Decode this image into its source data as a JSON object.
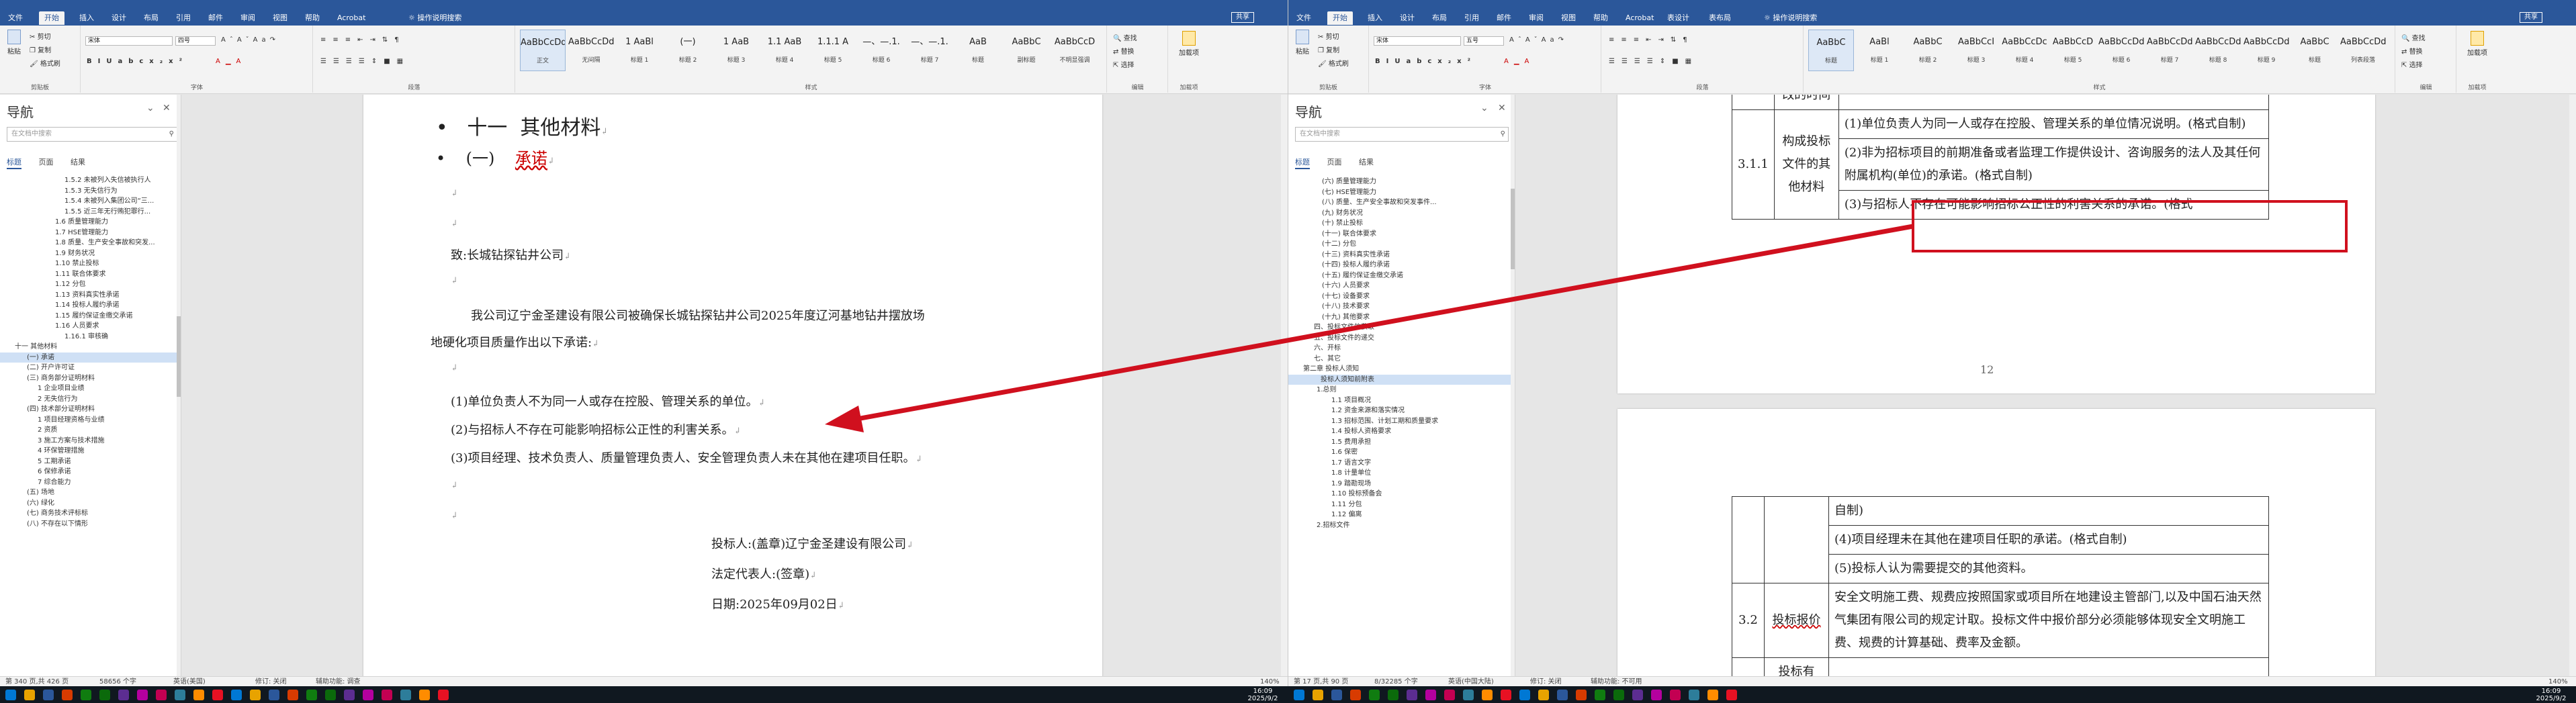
{
  "app": {
    "ribbon_tabs": [
      "文件",
      "开始",
      "插入",
      "设计",
      "布局",
      "引用",
      "邮件",
      "审阅",
      "视图",
      "帮助",
      "Acrobat"
    ],
    "ribbon_tabs_right": [
      "文件",
      "开始",
      "插入",
      "设计",
      "布局",
      "引用",
      "邮件",
      "审阅",
      "视图",
      "帮助",
      "Acrobat",
      "表设计",
      "表布局"
    ],
    "search": "操作说明搜索",
    "share": "共享",
    "clipboard": {
      "paste": "粘贴",
      "cut": "剪切",
      "copy": "复制",
      "format_painter": "格式刷",
      "label": "剪贴板"
    },
    "font": {
      "name_left": "宋体",
      "name_right": "宋体",
      "size_left": "四号",
      "size_right": "五号",
      "label": "字体"
    },
    "paragraph_label": "段落",
    "styles_label": "样式",
    "editing": {
      "find": "查找",
      "replace": "替换",
      "select": "选择",
      "label": "编辑"
    },
    "addin": {
      "name": "加载项",
      "label": "加载项"
    },
    "styles_left": [
      {
        "sample": "AaBbCcDd",
        "name": "正文"
      },
      {
        "sample": "AaBbCcDd",
        "name": "无间隔"
      },
      {
        "sample": "1 AaBl",
        "name": "标题 1"
      },
      {
        "sample": "(一)",
        "name": "标题 2"
      },
      {
        "sample": "1 AaB",
        "name": "标题 3"
      },
      {
        "sample": "1.1 AaB",
        "name": "标题 4"
      },
      {
        "sample": "1.1.1 A",
        "name": "标题 5"
      },
      {
        "sample": "—、—.1.",
        "name": "标题 6"
      },
      {
        "sample": "—、—.1.",
        "name": "标题 7"
      },
      {
        "sample": "AaB",
        "name": "标题"
      },
      {
        "sample": "AaBbC",
        "name": "副标题"
      },
      {
        "sample": "AaBbCcD",
        "name": "不明显强调"
      }
    ],
    "styles_right": [
      {
        "sample": "AaBbC",
        "name": "标题"
      },
      {
        "sample": "AaBl",
        "name": "标题 1"
      },
      {
        "sample": "AaBbC",
        "name": "标题 2"
      },
      {
        "sample": "AaBbCcI",
        "name": "标题 3"
      },
      {
        "sample": "AaBbCcDc",
        "name": "标题 4"
      },
      {
        "sample": "AaBbCcD",
        "name": "标题 5"
      },
      {
        "sample": "AaBbCcDd",
        "name": "标题 6"
      },
      {
        "sample": "AaBbCcDd",
        "name": "标题 7"
      },
      {
        "sample": "AaBbCcDd",
        "name": "标题 8"
      },
      {
        "sample": "AaBbCcDd",
        "name": "标题 9"
      },
      {
        "sample": "AaBbC",
        "name": "标题"
      },
      {
        "sample": "AaBbCcDd",
        "name": "列表段落"
      }
    ]
  },
  "nav": {
    "title": "导航",
    "search_placeholder": "在文档中搜索",
    "tabs": [
      "标题",
      "页面",
      "结果"
    ],
    "items_left": [
      "1.5.2 未被列入失信被执行人",
      "1.5.3 无失信行为",
      "1.5.4 未被列入集团公司“三...",
      "1.5.5 近三年无行贿犯罪行...",
      "1.6 质量管理能力",
      "1.7 HSE管理能力",
      "1.8 质量、生产安全事故和突发...",
      "1.9 财务状况",
      "1.10 禁止投标",
      "1.11 联合体要求",
      "1.12 分包",
      "1.13 资料真实性承诺",
      "1.14 投标人履约承诺",
      "1.15 履约保证金缴交承诺",
      "1.16 人员要求",
      "1.16.1 审核确",
      "十一 其他材料",
      "(一) 承诺",
      "(二) 开户许可证",
      "(三) 商务部分证明材料",
      "1 企业项目业绩",
      "2 无失信行为",
      "(四) 技术部分证明材料",
      "1 项目经理资格与业绩",
      "2 资质",
      "3 施工方案与技术措施",
      "4 环保管理措施",
      "5 工期承诺",
      "6 保修承诺",
      "7 综合能力",
      "(五) 场地",
      "(六) 绿化",
      "(七) 商务技术评标标",
      "(八) 不存在以下情形"
    ],
    "items_right": [
      "(六) 质量管理能力",
      "(七) HSE管理能力",
      "(八) 质量、生产安全事故和突发事件...",
      "(九) 财务状况",
      "(十) 禁止投标",
      "(十一) 联合体要求",
      "(十二) 分包",
      "(十三) 资料真实性承诺",
      "(十四) 投标人履约承诺",
      "(十五) 履约保证金缴交承诺",
      "(十六) 人员要求",
      "(十七) 设备要求",
      "(十八) 技术要求",
      "(十九) 其他要求",
      "四、投标文件的获取",
      "五、投标文件的递交",
      "六、开标",
      "七、其它",
      "第二章 投标人须知",
      "投标人须知前附表",
      "1.总则",
      "1.1 项目概况",
      "1.2 资金来源和落实情况",
      "1.3 招标范围、计划工期和质量要求",
      "1.4 投标人资格要求",
      "1.5 费用承担",
      "1.6 保密",
      "1.7 语言文字",
      "1.8 计量单位",
      "1.9 踏勘现场",
      "1.10 投标预备会",
      "1.11 分包",
      "1.12 偏离",
      "2.招标文件"
    ]
  },
  "doc_left": {
    "h1_num": "十一",
    "h1": "其他材料",
    "h2_num": "(一)",
    "h2": "承诺",
    "to": "致:长城钻探钻井公司",
    "body1": "我公司辽宁金圣建设有限公司被确保长城钻探钻井公司2025年度辽河基地钻井摆放场",
    "body2": "地硬化项目质量作出以下承诺:",
    "item1": "(1)单位负责人不为同一人或存在控股、管理关系的单位。",
    "item2": "(2)与招标人不存在可能影响招标公正性的利害关系。",
    "item3": "(3)项目经理、技术负责人、质量管理负责人、安全管理负责人未在其他在建项目任职。",
    "sign1": "投标人:(盖章)辽宁金圣建设有限公司",
    "sign2": "法定代表人:(签章)",
    "sign3": "日期:2025年09月02日"
  },
  "doc_right": {
    "t1_c0": "改的时间",
    "t2_c0": "3.1.1",
    "t2_c1": "构成投标文件的其他材料",
    "t2_r1": "(1)单位负责人为同一人或存在控股、管理关系的单位情况说明。(格式自制)",
    "t2_r2": "(2)非为招标项目的前期准备或者监理工作提供设计、咨询服务的法人及其任何附属机构(单位)的承诺。(格式自制)",
    "t2_r3": "(3)与招标人不存在可能影响招标公正性的利害关系的承诺。(格式",
    "page_num": "12",
    "t3_r0": "自制)",
    "t3_r1": "(4)项目经理未在其他在建项目任职的承诺。(格式自制)",
    "t3_r2": "(5)投标人认为需要提交的其他资料。",
    "t3_c0": "3.2",
    "t3_c1": "投标报价",
    "t3_r3": "安全文明施工费、规费应按照国家或项目所在地建设主管部门,以及中国石油天然气集团有限公司的规定计取。投标文件中报价部分必须能够体现安全文明施工费、规费的计算基础、费率及金额。",
    "t3_c1b": "投标有"
  },
  "status_left": {
    "page": "第 340 页,共 426 页",
    "words": "58656 个字",
    "lang": "英语(美国)",
    "track": "修订: 关闭",
    "access": "辅助功能: 调查",
    "zoom": "140%"
  },
  "status_right": {
    "page": "第 17 页,共 90 页",
    "words": "8/32285 个字",
    "lang": "英语(中国大陆)",
    "track": "修订: 关闭",
    "access": "辅助功能: 不可用",
    "zoom": "140%"
  },
  "clock_left": {
    "time": "16:09",
    "date": "2025/9/2"
  },
  "clock_right": {
    "time": "16:09",
    "date": "2025/9/2"
  },
  "colors": {
    "word_blue": "#2b579a",
    "highlight_red": "#d0101e",
    "nav_select": "#cfe0f5"
  }
}
